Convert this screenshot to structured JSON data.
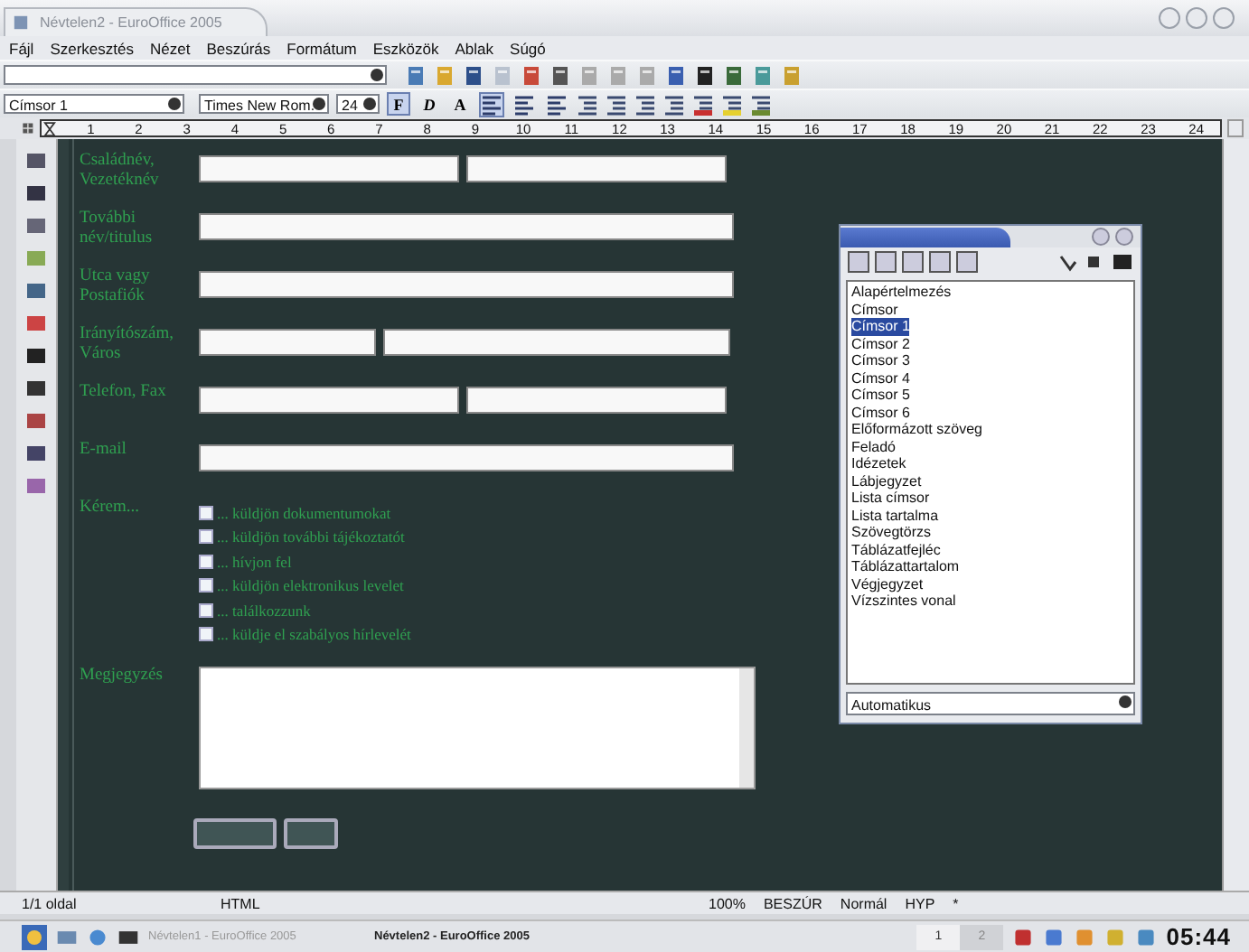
{
  "window": {
    "title": "Névtelen2 - EuroOffice 2005"
  },
  "menu": [
    "Fájl",
    "Szerkesztés",
    "Nézet",
    "Beszúrás",
    "Formátum",
    "Eszközök",
    "Ablak",
    "Súgó"
  ],
  "format_bar": {
    "style": "Címsor 1",
    "font": "Times New Rom.",
    "size": "24",
    "toggles": [
      {
        "label": "F",
        "selected": true
      },
      {
        "label": "D",
        "selected": false
      },
      {
        "label": "A",
        "selected": false
      }
    ],
    "align": [
      {
        "selected": true
      },
      {
        "selected": false
      },
      {
        "selected": false
      }
    ]
  },
  "ruler": [
    "1",
    "2",
    "3",
    "4",
    "5",
    "6",
    "7",
    "8",
    "9",
    "10",
    "11",
    "12",
    "13",
    "14",
    "15",
    "16",
    "17",
    "18",
    "19",
    "20",
    "21",
    "22",
    "23",
    "24"
  ],
  "form": {
    "rows": [
      {
        "label": "Családnév, Vezetéknév",
        "kind": "split"
      },
      {
        "label": "További név/titulus",
        "kind": "wide"
      },
      {
        "label": "Utca vagy Postafiók",
        "kind": "wide"
      },
      {
        "label": "Irányítószám, Város",
        "kind": "zip"
      },
      {
        "label": "Telefon, Fax",
        "kind": "split"
      },
      {
        "label": "E-mail",
        "kind": "wide"
      }
    ],
    "request": {
      "label": "Kérem...",
      "options": [
        {
          "label": "... küldjön dokumentumokat",
          "checked": false
        },
        {
          "label": "... küldjön további tájékoztatót",
          "checked": false
        },
        {
          "label": "... hívjon fel",
          "checked": false
        },
        {
          "label": "... küldjön elektronikus levelet",
          "checked": false
        },
        {
          "label": "... találkozzunk",
          "checked": false
        },
        {
          "label": "... küldje el szabályos hírlevelét",
          "checked": false
        }
      ]
    },
    "comment": {
      "label": "Megjegyzés"
    }
  },
  "styles_panel": {
    "items": [
      {
        "label": "Alapértelmezés",
        "selected": false
      },
      {
        "label": "Címsor",
        "selected": false
      },
      {
        "label": "Címsor 1",
        "selected": true
      },
      {
        "label": "Címsor 2",
        "selected": false
      },
      {
        "label": "Címsor 3",
        "selected": false
      },
      {
        "label": "Címsor 4",
        "selected": false
      },
      {
        "label": "Címsor 5",
        "selected": false
      },
      {
        "label": "Címsor 6",
        "selected": false
      },
      {
        "label": "Előformázott szöveg",
        "selected": false
      },
      {
        "label": "Feladó",
        "selected": false
      },
      {
        "label": "Idézetek",
        "selected": false
      },
      {
        "label": "Lábjegyzet",
        "selected": false
      },
      {
        "label": "Lista címsor",
        "selected": false
      },
      {
        "label": "Lista tartalma",
        "selected": false
      },
      {
        "label": "Szövegtörzs",
        "selected": false
      },
      {
        "label": "Táblázatfejléc",
        "selected": false
      },
      {
        "label": "Táblázattartalom",
        "selected": false
      },
      {
        "label": "Végjegyzet",
        "selected": false
      },
      {
        "label": "Vízszintes vonal",
        "selected": false
      }
    ],
    "filter": "Automatikus"
  },
  "status_bar": {
    "page": "1/1 oldal",
    "mode": "HTML",
    "zoom": "100%",
    "insert": "BESZÚR",
    "selection": "Normál",
    "hyperlink": "HYP",
    "modified": "*"
  },
  "taskbar": {
    "tasks": [
      {
        "label": "Névtelen1 - EuroOffice 2005",
        "selected": false
      },
      {
        "label": "Névtelen2 - EuroOffice 2005",
        "selected": true
      }
    ],
    "pager": [
      {
        "label": "1",
        "selected": true
      },
      {
        "label": "2",
        "selected": false
      }
    ],
    "clock": "05:44"
  }
}
